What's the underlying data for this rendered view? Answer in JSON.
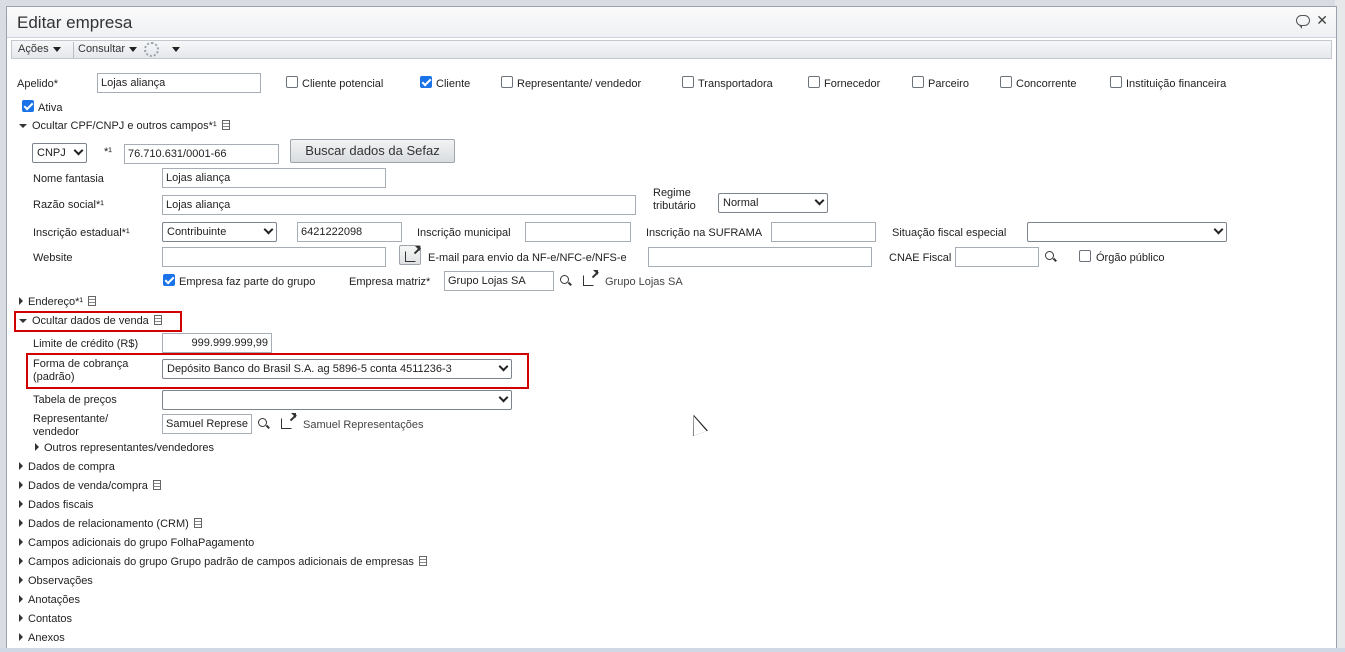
{
  "window": {
    "title": "Editar empresa"
  },
  "toolbar": {
    "acoes": "Ações",
    "consultar": "Consultar"
  },
  "top_row": {
    "apelido_label": "Apelido*",
    "apelido_value": "Lojas aliança",
    "checkboxes": [
      {
        "label": "Cliente potencial",
        "checked": false
      },
      {
        "label": "Cliente",
        "checked": true
      },
      {
        "label": "Representante/ vendedor",
        "checked": false
      },
      {
        "label": "Transportadora",
        "checked": false
      },
      {
        "label": "Fornecedor",
        "checked": false
      },
      {
        "label": "Parceiro",
        "checked": false
      },
      {
        "label": "Concorrente",
        "checked": false
      },
      {
        "label": "Instituição financeira",
        "checked": false
      }
    ],
    "ativa_label": "Ativa"
  },
  "cpf_section": {
    "toggle_label": "Ocultar CPF/CNPJ e outros campos*¹",
    "doc_type": "CNPJ",
    "doc_marker": "*¹",
    "doc_value": "76.710.631/0001-66",
    "sefaz_button": "Buscar dados da Sefaz",
    "nome_fantasia_label": "Nome fantasia",
    "nome_fantasia_value": "Lojas aliança",
    "razao_social_label": "Razão social*¹",
    "razao_social_value": "Lojas aliança",
    "regime_label_1": "Regime",
    "regime_label_2": "tributário",
    "regime_value": "Normal",
    "ie_label": "Inscrição estadual*¹",
    "ie_type": "Contribuinte",
    "ie_value": "6421222098",
    "im_label": "Inscrição municipal",
    "im_value": "",
    "suframa_label": "Inscrição na SUFRAMA",
    "suframa_value": "",
    "situacao_label": "Situação fiscal especial",
    "situacao_value": "",
    "website_label": "Website",
    "website_value": "",
    "email_label": "E-mail para envio da NF-e/NFC-e/NFS-e",
    "email_value": "",
    "cnae_label": "CNAE Fiscal",
    "cnae_value": "",
    "orgao_label": "Órgão público",
    "grupo_label": "Empresa faz parte do grupo",
    "matriz_label": "Empresa matriz*",
    "matriz_value": "Grupo Lojas SA",
    "matriz_link": "Grupo Lojas SA"
  },
  "endereco": {
    "label": "Endereço*¹"
  },
  "venda": {
    "toggle_label": "Ocultar dados de venda",
    "limite_label": "Limite de crédito (R$)",
    "limite_value": "999.999.999,99",
    "forma_label_1": "Forma de cobrança",
    "forma_label_2": "(padrão)",
    "forma_value": "Depósito Banco do Brasil S.A. ag 5896-5 conta 4511236-3",
    "tabela_label": "Tabela de preços",
    "tabela_value": "",
    "rep_label_1": "Representante/",
    "rep_label_2": "vendedor",
    "rep_value": "Samuel Represe",
    "rep_link": "Samuel Representações",
    "outros_label": "Outros representantes/vendedores"
  },
  "sections": [
    {
      "label": "Dados de compra",
      "doc": false
    },
    {
      "label": "Dados de venda/compra",
      "doc": true
    },
    {
      "label": "Dados fiscais",
      "doc": false
    },
    {
      "label": "Dados de relacionamento (CRM)",
      "doc": true
    },
    {
      "label": "Campos adicionais do grupo FolhaPagamento",
      "doc": false
    },
    {
      "label": "Campos adicionais do grupo Grupo padrão de campos adicionais de empresas",
      "doc": true
    },
    {
      "label": "Observações",
      "doc": false
    },
    {
      "label": "Anotações",
      "doc": false
    },
    {
      "label": "Contatos",
      "doc": false
    },
    {
      "label": "Anexos",
      "doc": false
    }
  ],
  "colors": {
    "highlight": "#d00000",
    "checkbox": "#1a73e8"
  }
}
